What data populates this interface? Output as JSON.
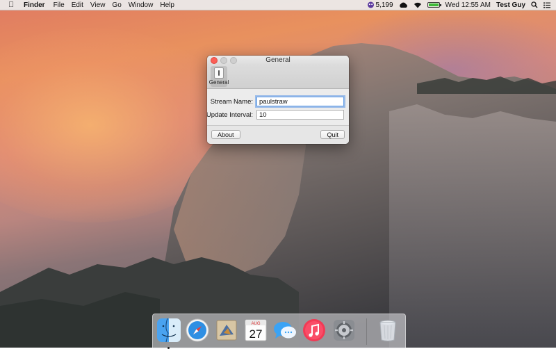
{
  "menubar": {
    "apple_icon": "apple-icon",
    "app_name": "Finder",
    "menus": [
      "File",
      "Edit",
      "View",
      "Go",
      "Window",
      "Help"
    ],
    "status": {
      "badge_count": "5,199",
      "clock": "Wed 12:55 AM",
      "user": "Test Guy",
      "battery_level": 1.0
    }
  },
  "window": {
    "title": "General",
    "toolbar": {
      "general_label": "General"
    },
    "fields": {
      "stream_name_label": "Stream Name:",
      "stream_name_value": "paulstraw",
      "update_interval_label": "Update Interval:",
      "update_interval_value": "10"
    },
    "buttons": {
      "about": "About",
      "quit": "Quit"
    }
  },
  "dock": {
    "items": [
      "finder-icon",
      "safari-icon",
      "mail-icon",
      "calendar-icon",
      "messages-icon",
      "itunes-icon",
      "system-preferences-icon",
      "trash-icon"
    ],
    "calendar": {
      "month": "AUG",
      "day": "27"
    }
  },
  "colors": {
    "accent": "#6aa3e8",
    "close": "#fc5f57",
    "battery": "#3fba3a"
  }
}
